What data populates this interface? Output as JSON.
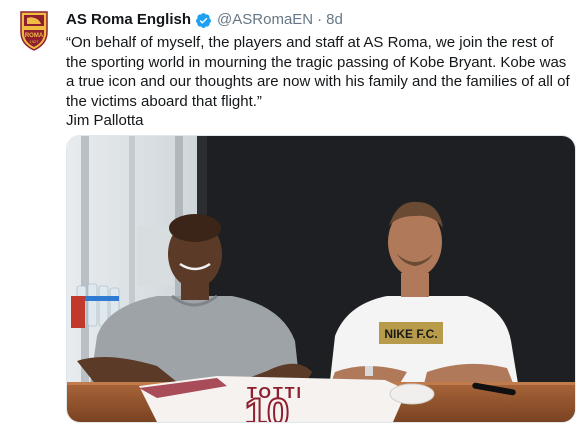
{
  "tweet": {
    "author_name": "AS Roma English",
    "handle": "@ASRomaEN",
    "separator": "·",
    "time": "8d",
    "quote": "“On behalf of myself, the players and staff at AS Roma, we join the rest of the sporting world in mourning the tragic passing of Kobe Bryant. Kobe was a true icon and our thoughts are now with his family and the families of all of the victims aboard that flight.”",
    "attribution": "Jim Pallotta",
    "avatar": {
      "logo_text": "ROMA",
      "year": "1927"
    },
    "photo": {
      "shirt_text": "NIKE F.C.",
      "jersey_name": "TOTTI",
      "jersey_number": "10"
    }
  },
  "colors": {
    "text": "#14171a",
    "secondary": "#657786",
    "verified": "#1da1f2",
    "roma_red": "#8e1f2f",
    "roma_gold": "#f0bc42"
  },
  "icons": {
    "verified": "verified-badge-icon"
  }
}
